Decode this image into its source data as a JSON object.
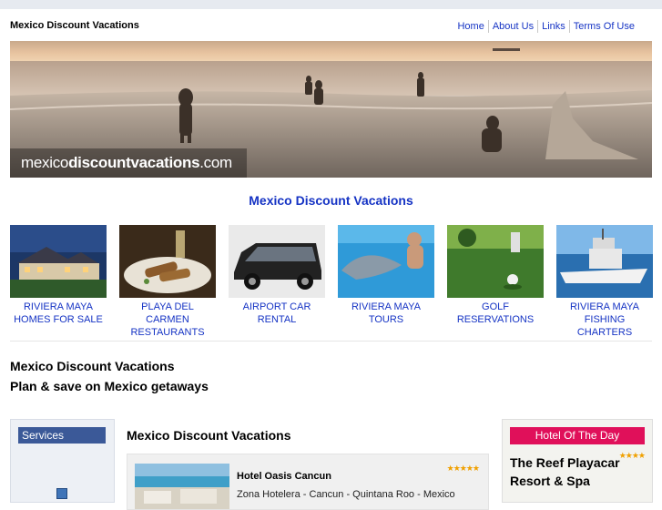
{
  "header": {
    "site_title": "Mexico Discount Vacations",
    "nav": [
      "Home",
      "About Us",
      "Links",
      "Terms Of Use"
    ]
  },
  "banner": {
    "logo_light": "mexico",
    "logo_bold": "discountvacations",
    "logo_suffix": ".com"
  },
  "main_heading": "Mexico Discount Vacations",
  "tiles": [
    {
      "line1": "RIVIERA MAYA",
      "line2": "HOMES FOR SALE"
    },
    {
      "line1": "PLAYA DEL CARMEN",
      "line2": "RESTAURANTS"
    },
    {
      "line1": "AIRPORT CAR",
      "line2": "RENTAL"
    },
    {
      "line1": "RIVIERA MAYA",
      "line2": "TOURS"
    },
    {
      "line1": "GOLF",
      "line2": "RESERVATIONS"
    },
    {
      "line1": "RIVIERA MAYA",
      "line2": "FISHING CHARTERS"
    }
  ],
  "intro": {
    "title": "Mexico Discount Vacations",
    "subtitle": "Plan & save on Mexico getaways"
  },
  "sidebar": {
    "tab_label": "Services"
  },
  "content": {
    "heading": "Mexico Discount Vacations",
    "hotel": {
      "name": "Hotel Oasis Cancun",
      "address": "Zona Hotelera - Cancun - Quintana Roo - Mexico",
      "stars": "★★★★★"
    }
  },
  "hotel_of_day": {
    "label": "Hotel Of The Day",
    "stars": "★★★★",
    "name": "The Reef Playacar Resort & Spa"
  }
}
